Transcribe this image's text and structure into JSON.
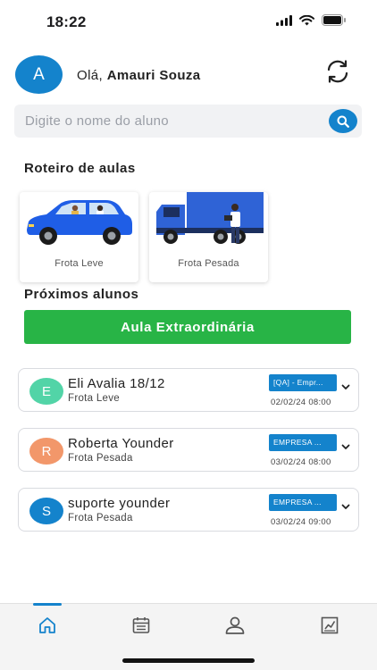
{
  "status_bar": {
    "time": "18:22"
  },
  "header": {
    "avatar_initial": "A",
    "greeting_prefix": "Olá,",
    "user_name": "Amauri Souza"
  },
  "search": {
    "placeholder": "Digite o nome do aluno"
  },
  "routes": {
    "title": "Roteiro de aulas",
    "items": [
      {
        "label": "Frota Leve"
      },
      {
        "label": "Frota Pesada"
      }
    ]
  },
  "upcoming": {
    "title": "Próximos alunos",
    "extra_button_label": "Aula Extraordinária",
    "students": [
      {
        "initial": "E",
        "name": "Eli Avalia 18/12",
        "fleet": "Frota Leve",
        "company": "[QA] - Empr...",
        "datetime": "02/02/24 08:00",
        "avatar_color": "#52d4a7"
      },
      {
        "initial": "R",
        "name": "Roberta Younder",
        "fleet": "Frota Pesada",
        "company": "EMPRESA ...",
        "datetime": "03/02/24 08:00",
        "avatar_color": "#f2976a"
      },
      {
        "initial": "S",
        "name": "suporte younder",
        "fleet": "Frota Pesada",
        "company": "EMPRESA ...",
        "datetime": "03/02/24 09:00",
        "avatar_color": "#1483cc"
      }
    ]
  },
  "tabbar": {
    "tabs": [
      {
        "icon": "home-icon",
        "active": true
      },
      {
        "icon": "calendar-icon",
        "active": false
      },
      {
        "icon": "profile-icon",
        "active": false
      },
      {
        "icon": "report-icon",
        "active": false
      }
    ]
  },
  "colors": {
    "primary": "#1483cc",
    "success": "#28b446",
    "search_bg": "#f1f2f4"
  }
}
